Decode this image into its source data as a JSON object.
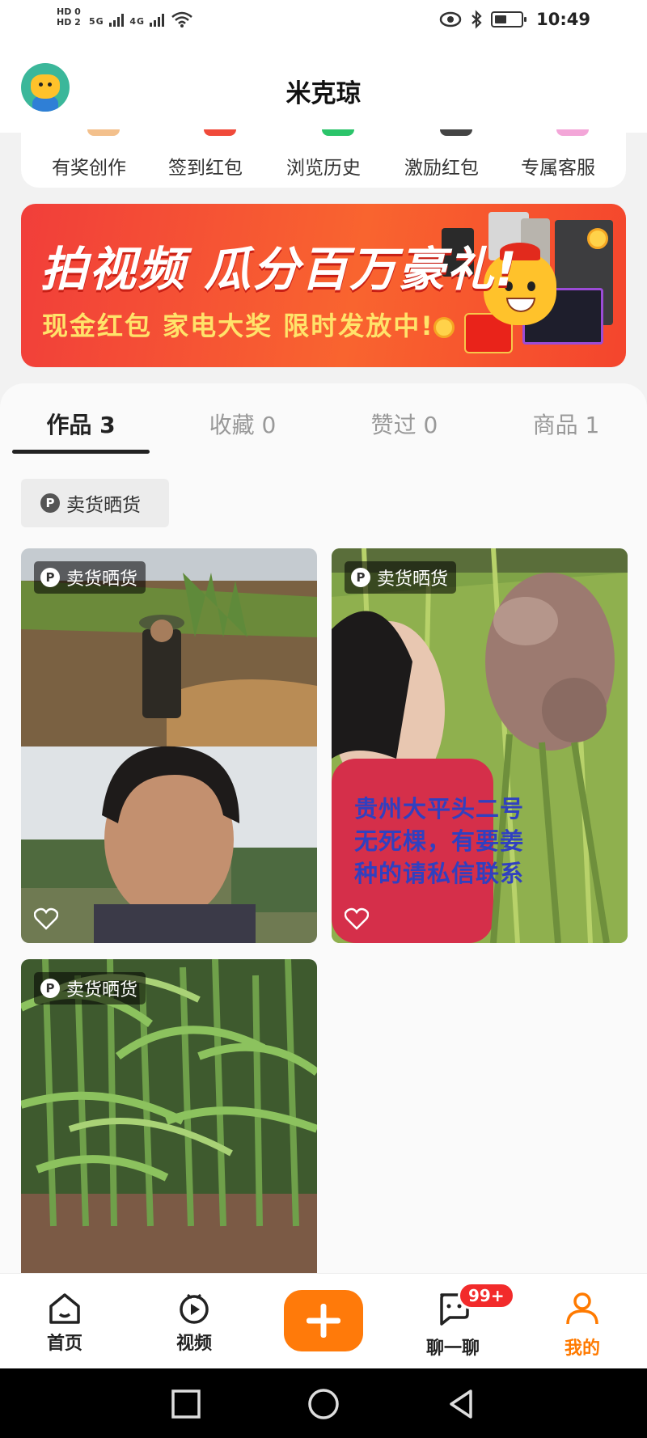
{
  "status_bar": {
    "hd1": "HD 0",
    "hd2": "HD 2",
    "net1": "5G",
    "net2": "4G",
    "time": "10:49"
  },
  "header": {
    "title": "米克琼"
  },
  "quick_actions": [
    {
      "label": "有奖创作",
      "color": "#f3c08c"
    },
    {
      "label": "签到红包",
      "color": "#f04a3a"
    },
    {
      "label": "浏览历史",
      "color": "#2bc46a"
    },
    {
      "label": "激励红包",
      "color": "#444444"
    },
    {
      "label": "专属客服",
      "color": "#f3a6d8"
    }
  ],
  "banner": {
    "title": "拍视频 瓜分百万豪礼!",
    "subtitle": "现金红包 家电大奖 限时发放中!"
  },
  "tabs": [
    {
      "label": "作品 3",
      "active": true
    },
    {
      "label": "收藏 0",
      "active": false
    },
    {
      "label": "赞过 0",
      "active": false
    },
    {
      "label": "商品 1",
      "active": false
    }
  ],
  "filter_chip": {
    "badge": "P",
    "label": "卖货晒货"
  },
  "cards": [
    {
      "tag": "卖货晒货",
      "badge": "P",
      "overlay_lines": []
    },
    {
      "tag": "卖货晒货",
      "badge": "P",
      "overlay_lines": [
        "贵州大平头二号",
        "无死棵，有要姜",
        "种的请私信联系"
      ]
    },
    {
      "tag": "卖货晒货",
      "badge": "P",
      "overlay_lines": []
    }
  ],
  "bottom_nav": {
    "home": "首页",
    "video": "视频",
    "chat": "聊一聊",
    "chat_badge": "99+",
    "me": "我的",
    "accent": "#ff7a00"
  }
}
